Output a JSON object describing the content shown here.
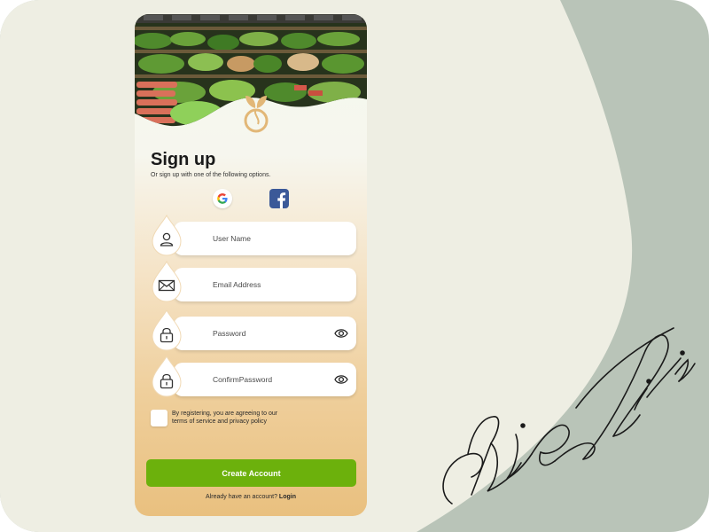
{
  "form": {
    "title": "Sign up",
    "subtitle": "Or sign up with one of the following options.",
    "fields": [
      {
        "label": "User Name",
        "icon": "user-icon"
      },
      {
        "label": "Email Address",
        "icon": "envelope-icon"
      },
      {
        "label": "Password",
        "icon": "lock-icon",
        "toggle": "eye-icon"
      },
      {
        "label": "ConfirmPassword",
        "icon": "lock-icon",
        "toggle": "eye-icon"
      }
    ],
    "terms_line1": "By registering, you are agreeing to our",
    "terms_line2": "terms of service and privacy policy",
    "create_button": "Create Account",
    "login_prompt": "Already have an account?",
    "login_link": "Login"
  },
  "social": [
    {
      "name": "google",
      "icon": "google-icon"
    },
    {
      "name": "facebook",
      "icon": "facebook-icon"
    }
  ],
  "signature": "NideLilian",
  "colors": {
    "accent": "#6cb10c",
    "background_sage": "#b9c4b8",
    "background_cream": "#eeeee3",
    "card_gradient_end": "#e9c07f",
    "logo": "#e2b777"
  }
}
